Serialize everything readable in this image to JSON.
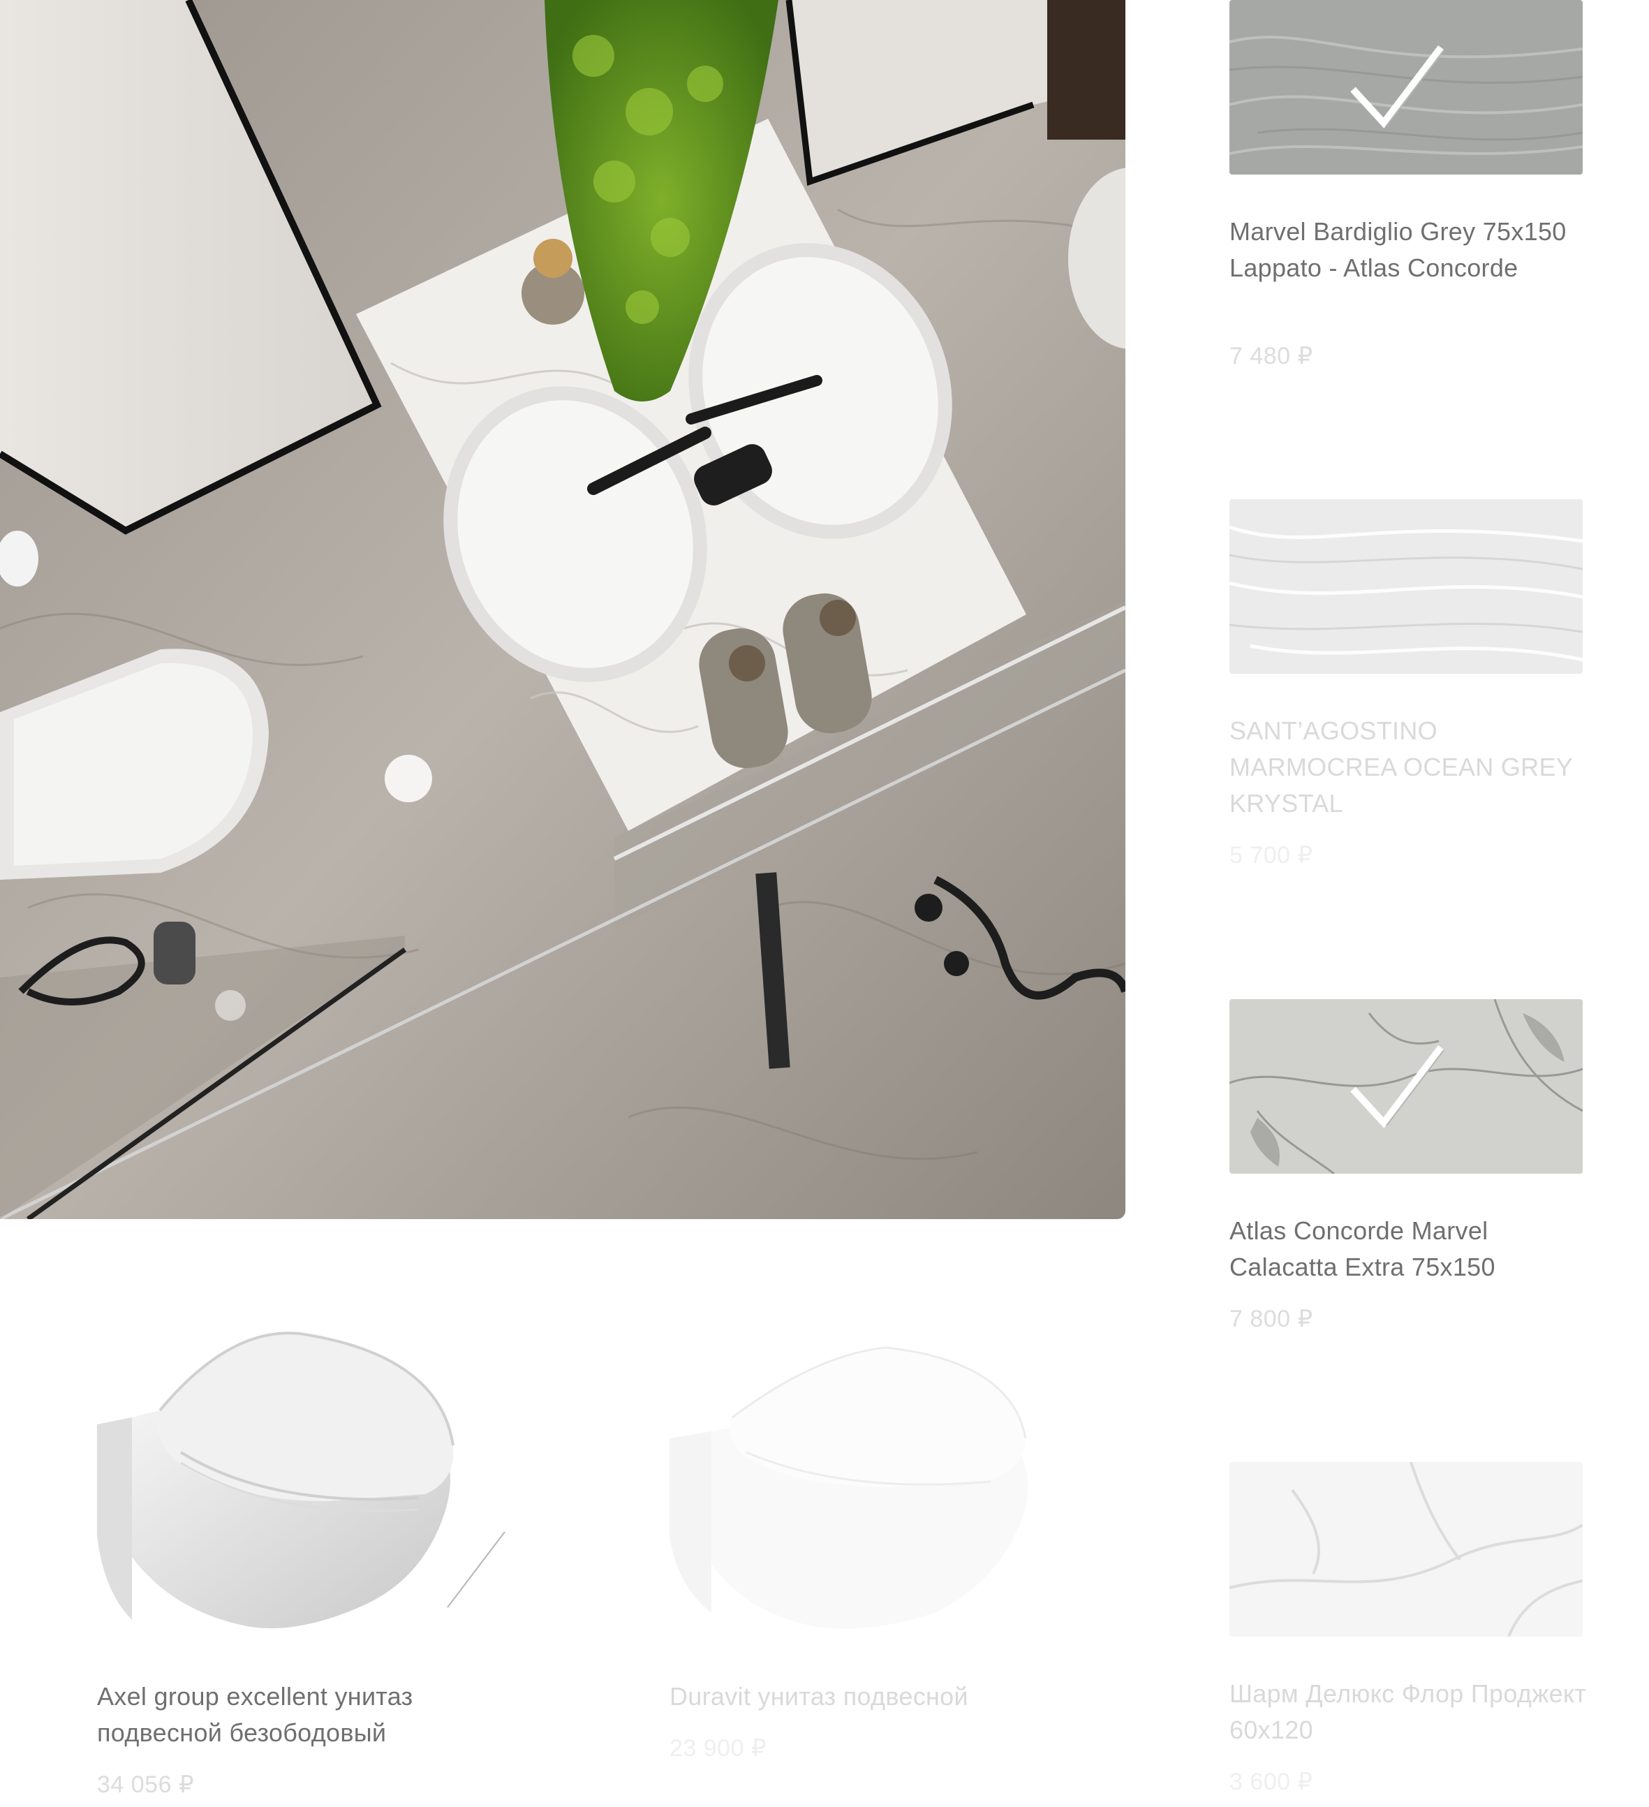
{
  "hero": {
    "alt_icon": "bathroom-render-image"
  },
  "tiles": [
    {
      "title": "Marvel Bardiglio Grey 75x150 Lappato - Atlas Concorde",
      "price": "7 480 ₽",
      "selected": true,
      "swatch": "#a8aaa8"
    },
    {
      "title": "SANT’AGOSTINO MARMOCREA OCEAN GREY KRYSTAL",
      "price": "5 700 ₽",
      "selected": false,
      "swatch": "#eeeeee"
    },
    {
      "title": "Atlas Concorde Marvel Calacatta Extra 75x150",
      "price": "7 800 ₽",
      "selected": true,
      "swatch": "#cfcfcb"
    },
    {
      "title": "Шарм Делюкс Флор Проджект 60х120",
      "price": "3 600 ₽",
      "selected": false,
      "swatch": "#f6f6f6"
    }
  ],
  "toilets": [
    {
      "title": "Axel group excellent унитаз подвесной безободовый",
      "price": "34 056 ₽",
      "selected": true
    },
    {
      "title": "Duravit унитаз подвесной",
      "price": "23 900 ₽",
      "selected": false
    }
  ],
  "colors": {
    "active_text": "#6f6f6f",
    "dim_text": "#d9d9d9",
    "check": "#ffffff"
  }
}
